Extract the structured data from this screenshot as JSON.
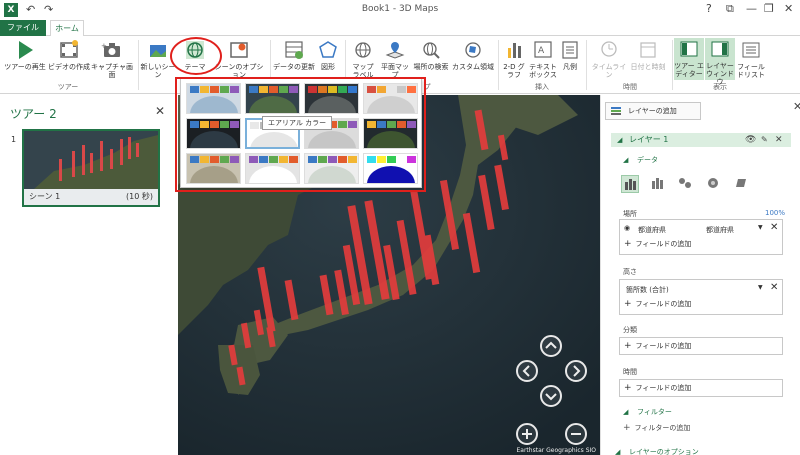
{
  "window": {
    "app_badge": "X",
    "title": "Book1 - 3D Maps",
    "undo_symbol": "↶",
    "redo_symbol": "↷",
    "help": "?",
    "restore_down": "⧉",
    "minimize": "—",
    "restore": "❐",
    "close": "✕"
  },
  "tabs": {
    "file": "ファイル",
    "home": "ホーム"
  },
  "ribbon": {
    "tour_play": "ツアーの再生",
    "create_video": "ビデオの作成",
    "capture_screen": "キャプチャ画面",
    "group_tour": "ツアー",
    "new_scene": "新しいシーン",
    "themes": "テーマ",
    "scene_options": "シーンのオプション",
    "refresh_data": "データの更新",
    "shapes": "図形",
    "map_labels": "マップ ラベル",
    "flat_map": "平面マップ",
    "find_location": "場所の検索",
    "custom_regions": "カスタム領域",
    "group_map_tail": "プ",
    "chart_2d": "2-D グラフ",
    "text_box": "テキスト ボックス",
    "legend": "凡例",
    "group_insert": "挿入",
    "timeline": "タイムライン",
    "date_time": "日付と時刻",
    "group_time": "時間",
    "tour_editor": "ツアー エディター",
    "layer_window": "レイヤー ウィンドウ",
    "field_list": "フィール ドリスト",
    "group_view": "表示"
  },
  "theme_gallery": {
    "tooltip": "エアリアル カラー",
    "selected_index": 5
  },
  "tour_panel": {
    "title": "ツアー 2",
    "close": "✕",
    "scene_number": "1",
    "scene_name": "シーン 1",
    "scene_duration": "(10 秒)"
  },
  "map": {
    "credit": "Earthstar Geographics  SIO"
  },
  "layer_pane": {
    "close": "✕",
    "add_layer": "レイヤーの追加",
    "layer_name": "レイヤー 1",
    "data_section": "データ",
    "location_label": "場所",
    "location_percent": "100%",
    "location_field": "都道府県",
    "location_type": "都道府県",
    "add_field": "フィールドの追加",
    "height_label": "高さ",
    "height_field": "箇所数 (合計)",
    "category_label": "分類",
    "time_label": "時間",
    "filter_section": "フィルター",
    "add_filter": "フィルターの追加",
    "layer_options": "レイヤーのオプション"
  },
  "colors": {
    "accent": "#217346",
    "highlight_red": "#e0201c",
    "bar_red": "#e63c3c",
    "ocean": "#1f2d35"
  }
}
